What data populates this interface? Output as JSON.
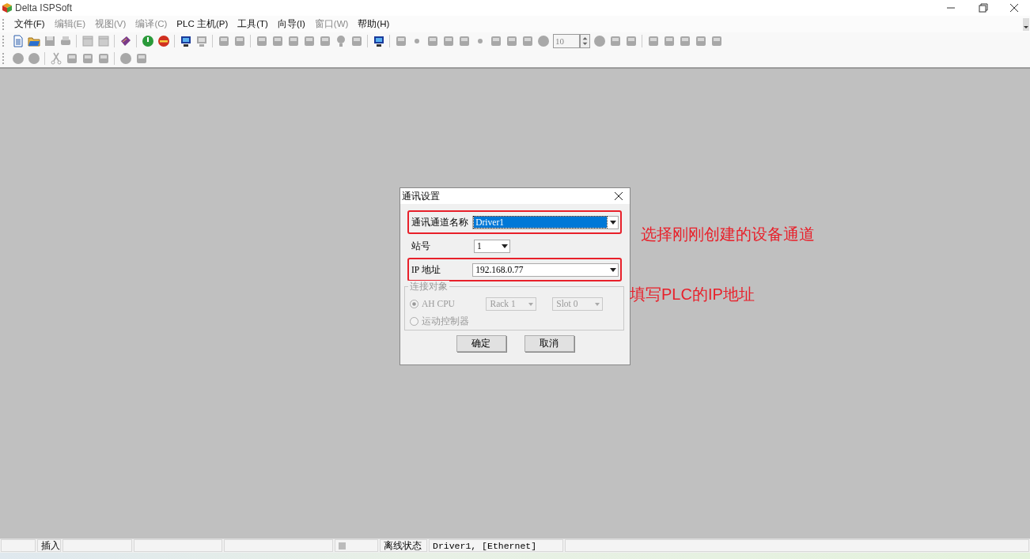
{
  "window": {
    "title": "Delta ISPSoft"
  },
  "menu": [
    {
      "label": "文件(F)",
      "disabled": false
    },
    {
      "label": "编辑(E)",
      "disabled": true
    },
    {
      "label": "视图(V)",
      "disabled": true
    },
    {
      "label": "编译(C)",
      "disabled": true
    },
    {
      "label": "PLC 主机(P)",
      "disabled": false
    },
    {
      "label": "工具(T)",
      "disabled": false
    },
    {
      "label": "向导(I)",
      "disabled": false
    },
    {
      "label": "窗口(W)",
      "disabled": true
    },
    {
      "label": "帮助(H)",
      "disabled": false
    }
  ],
  "toolbar_1": [
    {
      "kind": "document",
      "disabled": false
    },
    {
      "kind": "folder",
      "disabled": false
    },
    {
      "kind": "disk",
      "disabled": true
    },
    {
      "kind": "printer",
      "disabled": true
    },
    {
      "kind": "separator"
    },
    {
      "kind": "panel",
      "disabled": true
    },
    {
      "kind": "panel",
      "disabled": true
    },
    {
      "kind": "separator"
    },
    {
      "kind": "book",
      "disabled": false
    },
    {
      "kind": "separator"
    },
    {
      "kind": "go",
      "disabled": false
    },
    {
      "kind": "stop",
      "disabled": false
    },
    {
      "kind": "separator"
    },
    {
      "kind": "monitor",
      "disabled": false
    },
    {
      "kind": "monitor",
      "disabled": true
    },
    {
      "kind": "separator"
    },
    {
      "kind": "generic",
      "disabled": true
    },
    {
      "kind": "generic",
      "disabled": true
    },
    {
      "kind": "separator"
    },
    {
      "kind": "generic",
      "disabled": true
    },
    {
      "kind": "generic",
      "disabled": true
    },
    {
      "kind": "generic",
      "disabled": true
    },
    {
      "kind": "generic",
      "disabled": true
    },
    {
      "kind": "generic",
      "disabled": true
    },
    {
      "kind": "bulb",
      "disabled": true
    },
    {
      "kind": "generic",
      "disabled": true
    },
    {
      "kind": "separator"
    },
    {
      "kind": "monitor",
      "disabled": false
    },
    {
      "kind": "separator"
    },
    {
      "kind": "generic",
      "disabled": true
    },
    {
      "kind": "dot",
      "disabled": true
    },
    {
      "kind": "generic",
      "disabled": true
    },
    {
      "kind": "generic",
      "disabled": true
    },
    {
      "kind": "generic",
      "disabled": true
    },
    {
      "kind": "dot",
      "disabled": true
    },
    {
      "kind": "generic",
      "disabled": true
    },
    {
      "kind": "generic",
      "disabled": true
    },
    {
      "kind": "generic",
      "disabled": true
    },
    {
      "kind": "circle",
      "disabled": true
    },
    {
      "kind": "spin",
      "value": "10",
      "disabled": true
    },
    {
      "kind": "circle",
      "disabled": true
    },
    {
      "kind": "generic",
      "disabled": true
    },
    {
      "kind": "generic",
      "disabled": true
    },
    {
      "kind": "separator"
    },
    {
      "kind": "generic",
      "disabled": true
    },
    {
      "kind": "generic",
      "disabled": true
    },
    {
      "kind": "generic",
      "disabled": true
    },
    {
      "kind": "generic",
      "disabled": true
    },
    {
      "kind": "generic",
      "disabled": true
    }
  ],
  "toolbar_2": [
    {
      "kind": "circle",
      "disabled": true
    },
    {
      "kind": "circle",
      "disabled": true
    },
    {
      "kind": "separator"
    },
    {
      "kind": "scissors",
      "disabled": true
    },
    {
      "kind": "generic",
      "disabled": true
    },
    {
      "kind": "generic",
      "disabled": true
    },
    {
      "kind": "generic",
      "disabled": true
    },
    {
      "kind": "separator"
    },
    {
      "kind": "circle",
      "disabled": true
    },
    {
      "kind": "generic",
      "disabled": true
    }
  ],
  "dialog": {
    "title": "通讯设置",
    "fields": [
      {
        "label": "通讯通道名称",
        "value": "Driver1",
        "kind": "wide",
        "focused": true,
        "highlighted": true
      },
      {
        "label": "站号",
        "value": "1",
        "kind": "narrow",
        "focused": false,
        "highlighted": false
      },
      {
        "label": "IP  地址",
        "value": "192.168.0.77",
        "kind": "wide",
        "focused": false,
        "highlighted": true
      }
    ],
    "group": {
      "title": "连接对象",
      "disabled": true,
      "options": [
        {
          "label": "AH CPU",
          "selected": true,
          "dropdowns": [
            "Rack 1",
            "Slot 0"
          ]
        },
        {
          "label": "运动控制器",
          "selected": false
        }
      ]
    },
    "buttons": [
      "确定",
      "取消"
    ]
  },
  "annotations": [
    "选择刚刚创建的设备通道",
    "填写PLC的IP地址"
  ],
  "status_bar": [
    {
      "kind": "empty"
    },
    {
      "kind": "text",
      "text": "插入"
    },
    {
      "kind": "empty"
    },
    {
      "kind": "empty"
    },
    {
      "kind": "empty"
    },
    {
      "kind": "indicator"
    },
    {
      "kind": "text",
      "text": "离线状态"
    },
    {
      "kind": "text",
      "text": "Driver1, [Ethernet]"
    },
    {
      "kind": "empty"
    }
  ]
}
